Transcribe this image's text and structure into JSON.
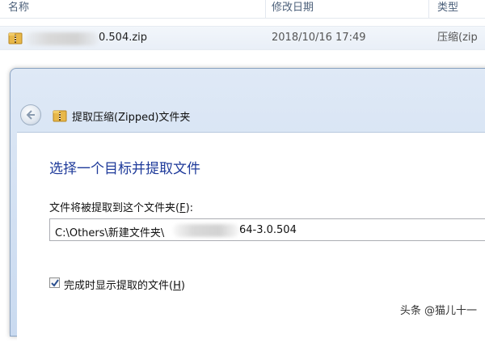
{
  "explorer": {
    "columns": {
      "name": "名称",
      "date_modified": "修改日期",
      "type": "类型"
    },
    "file": {
      "name_suffix": "0.504.zip",
      "date_modified": "2018/10/16 17:49",
      "type": "压缩(zip"
    }
  },
  "dialog": {
    "title": "提取压缩(Zipped)文件夹",
    "instruction": "选择一个目标并提取文件",
    "folder_label_before": "文件将被提取到这个文件夹(",
    "folder_label_key": "F",
    "folder_label_after": "):",
    "path_prefix": "C:\\Others\\新建文件夹\\",
    "path_suffix": "64-3.0.504",
    "show_files_checked": true,
    "show_files_label_before": "完成时显示提取的文件(",
    "show_files_label_key": "H",
    "show_files_label_after": ")"
  },
  "watermark": "头条 @猫儿十一",
  "colors": {
    "instruction": "#1e3a9a",
    "dialog_frame": "#c9daf0"
  }
}
